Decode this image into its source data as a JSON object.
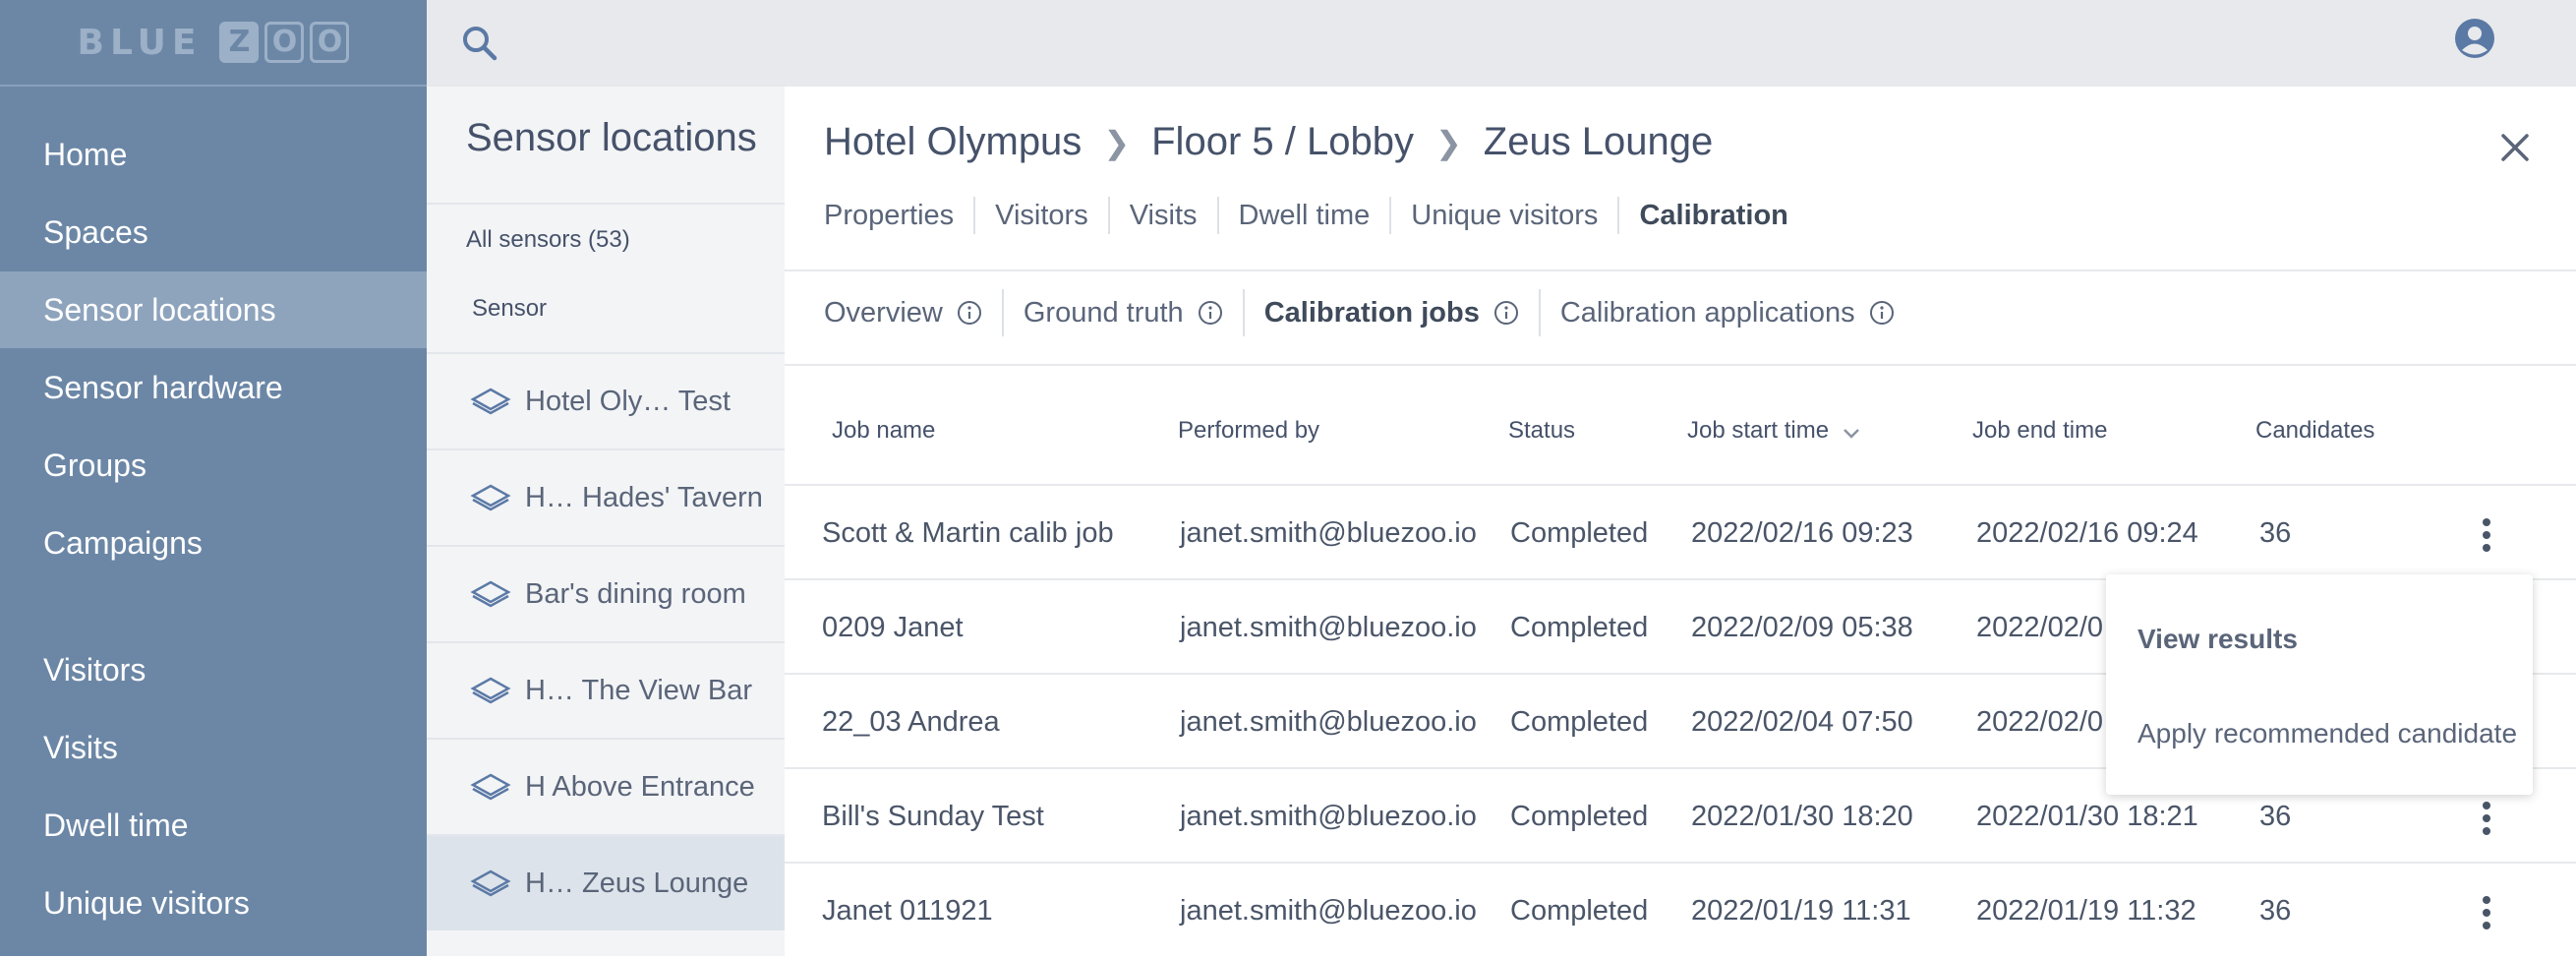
{
  "logo": {
    "word": "BLUE",
    "boxes": [
      "Z",
      "O",
      "O"
    ]
  },
  "sidebar": {
    "items": [
      {
        "label": "Home"
      },
      {
        "label": "Spaces"
      },
      {
        "label": "Sensor locations",
        "active": true
      },
      {
        "label": "Sensor hardware"
      },
      {
        "label": "Groups"
      },
      {
        "label": "Campaigns"
      },
      {
        "label": "Visitors"
      },
      {
        "label": "Visits"
      },
      {
        "label": "Dwell time"
      },
      {
        "label": "Unique visitors"
      }
    ]
  },
  "topbar": {
    "search_icon": "search-icon",
    "account_icon": "account-circle-icon"
  },
  "list_panel": {
    "title": "Sensor locations",
    "count_label": "All sensors (53)",
    "column_label": "Sensor",
    "rows": [
      {
        "label": "Hotel Oly…   Test"
      },
      {
        "label": "H… Hades' Tavern"
      },
      {
        "label": " Bar's dining room"
      },
      {
        "label": "H…  The View Bar"
      },
      {
        "label": "H Above Entrance"
      },
      {
        "label": "H…   Zeus Lounge",
        "selected": true
      }
    ]
  },
  "detail": {
    "breadcrumb": [
      "Hotel Olympus",
      "Floor 5 / Lobby",
      "Zeus Lounge"
    ],
    "separator": "❯",
    "tabs": [
      "Properties",
      "Visitors",
      "Visits",
      "Dwell time",
      "Unique visitors",
      "Calibration"
    ],
    "active_tab": "Calibration",
    "subtabs": [
      "Overview",
      "Ground truth",
      "Calibration jobs",
      "Calibration applications"
    ],
    "active_subtab": "Calibration jobs",
    "table": {
      "headers": [
        "Job name",
        "Performed by",
        "Status",
        "Job start time",
        "Job end time",
        "Candidates"
      ],
      "sorted_column": "Job start time",
      "rows": [
        {
          "name": "Scott & Martin calib job",
          "by": "janet.smith@bluezoo.io",
          "status": "Completed",
          "start": "2022/02/16 09:23",
          "end": "2022/02/16 09:24",
          "candidates": "36"
        },
        {
          "name": "0209 Janet",
          "by": "janet.smith@bluezoo.io",
          "status": "Completed",
          "start": "2022/02/09 05:38",
          "end": "2022/02/0",
          "candidates": ""
        },
        {
          "name": "22_03 Andrea",
          "by": "janet.smith@bluezoo.io",
          "status": "Completed",
          "start": "2022/02/04 07:50",
          "end": "2022/02/0",
          "candidates": ""
        },
        {
          "name": "Bill's Sunday Test",
          "by": "janet.smith@bluezoo.io",
          "status": "Completed",
          "start": "2022/01/30 18:20",
          "end": "2022/01/30 18:21",
          "candidates": "36"
        },
        {
          "name": "Janet 011921",
          "by": "janet.smith@bluezoo.io",
          "status": "Completed",
          "start": "2022/01/19 11:31",
          "end": "2022/01/19 11:32",
          "candidates": "36"
        }
      ]
    },
    "menu": {
      "items": [
        "View results",
        "Apply recommended candidate"
      ]
    }
  },
  "colors": {
    "sidebar": "#6c87a6",
    "sidebar_active": "#8ea4bd",
    "topbar": "#e7e9ec",
    "list_panel": "#f3f4f6",
    "icon": "#5b79a5"
  }
}
